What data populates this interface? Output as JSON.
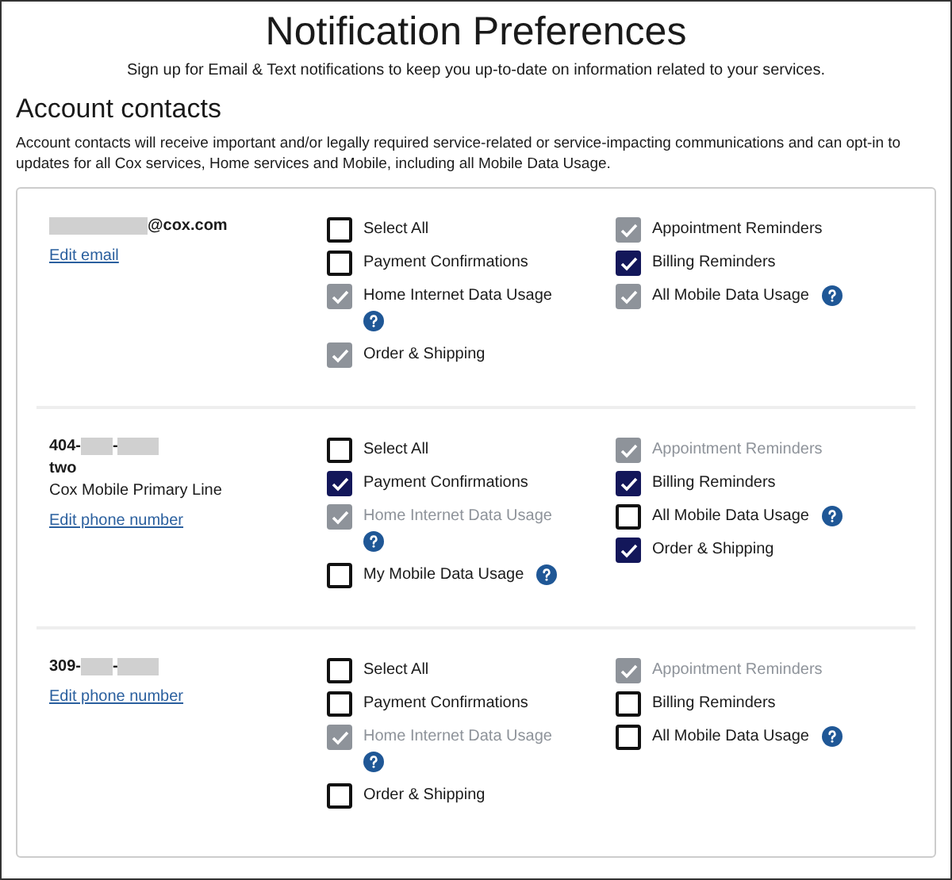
{
  "title": "Notification Preferences",
  "subtitle": "Sign up for Email & Text notifications to keep you up-to-date on information related to your services.",
  "section": {
    "heading": "Account contacts",
    "description": "Account contacts will receive important and/or legally required service-related or service-impacting communications and can opt-in to updates for all Cox services, Home services and Mobile, including all Mobile Data Usage."
  },
  "contacts": [
    {
      "address": [
        {
          "kind": "redacted"
        },
        {
          "kind": "text",
          "text": "@cox.com"
        }
      ],
      "edit_link": "Edit email",
      "columns": [
        [
          {
            "label": "Select All",
            "checked": false,
            "disabled": false,
            "muted": false,
            "help": false
          },
          {
            "label": "Payment Confirmations",
            "checked": false,
            "disabled": false,
            "muted": false,
            "help": false
          },
          {
            "label": "Home Internet Data Usage",
            "checked": true,
            "disabled": true,
            "muted": false,
            "help": true
          },
          {
            "label": "Order & Shipping",
            "checked": true,
            "disabled": true,
            "muted": false,
            "help": false
          }
        ],
        [
          {
            "label": "Appointment Reminders",
            "checked": true,
            "disabled": true,
            "muted": false,
            "help": false
          },
          {
            "label": "Billing Reminders",
            "checked": true,
            "disabled": false,
            "muted": false,
            "help": false
          },
          {
            "label": "All Mobile Data Usage",
            "checked": true,
            "disabled": true,
            "muted": false,
            "help": true
          }
        ]
      ]
    },
    {
      "address": [
        {
          "kind": "text",
          "text": "404-"
        },
        {
          "kind": "redacted"
        },
        {
          "kind": "text",
          "text": "-"
        },
        {
          "kind": "redacted"
        }
      ],
      "details": [
        {
          "text": "two",
          "bold": true
        },
        {
          "text": "Cox Mobile Primary Line",
          "bold": false
        }
      ],
      "edit_link": "Edit phone number",
      "columns": [
        [
          {
            "label": "Select All",
            "checked": false,
            "disabled": false,
            "muted": false,
            "help": false
          },
          {
            "label": "Payment Confirmations",
            "checked": true,
            "disabled": false,
            "muted": false,
            "help": false
          },
          {
            "label": "Home Internet Data Usage",
            "checked": true,
            "disabled": true,
            "muted": true,
            "help": true
          },
          {
            "label": "My Mobile Data Usage",
            "checked": false,
            "disabled": false,
            "muted": false,
            "help": true
          }
        ],
        [
          {
            "label": "Appointment Reminders",
            "checked": true,
            "disabled": true,
            "muted": true,
            "help": false
          },
          {
            "label": "Billing Reminders",
            "checked": true,
            "disabled": false,
            "muted": false,
            "help": false
          },
          {
            "label": "All Mobile Data Usage",
            "checked": false,
            "disabled": false,
            "muted": false,
            "help": true
          },
          {
            "label": "Order & Shipping",
            "checked": true,
            "disabled": false,
            "muted": false,
            "help": false
          }
        ]
      ]
    },
    {
      "address": [
        {
          "kind": "text",
          "text": "309-"
        },
        {
          "kind": "redacted"
        },
        {
          "kind": "text",
          "text": "-"
        },
        {
          "kind": "redacted"
        }
      ],
      "edit_link": "Edit phone number",
      "columns": [
        [
          {
            "label": "Select All",
            "checked": false,
            "disabled": false,
            "muted": false,
            "help": false
          },
          {
            "label": "Payment Confirmations",
            "checked": false,
            "disabled": false,
            "muted": false,
            "help": false
          },
          {
            "label": "Home Internet Data Usage",
            "checked": true,
            "disabled": true,
            "muted": true,
            "help": true
          },
          {
            "label": "Order & Shipping",
            "checked": false,
            "disabled": false,
            "muted": false,
            "help": false
          }
        ],
        [
          {
            "label": "Appointment Reminders",
            "checked": true,
            "disabled": true,
            "muted": true,
            "help": false
          },
          {
            "label": "Billing Reminders",
            "checked": false,
            "disabled": false,
            "muted": false,
            "help": false
          },
          {
            "label": "All Mobile Data Usage",
            "checked": false,
            "disabled": false,
            "muted": false,
            "help": true
          }
        ]
      ]
    }
  ]
}
